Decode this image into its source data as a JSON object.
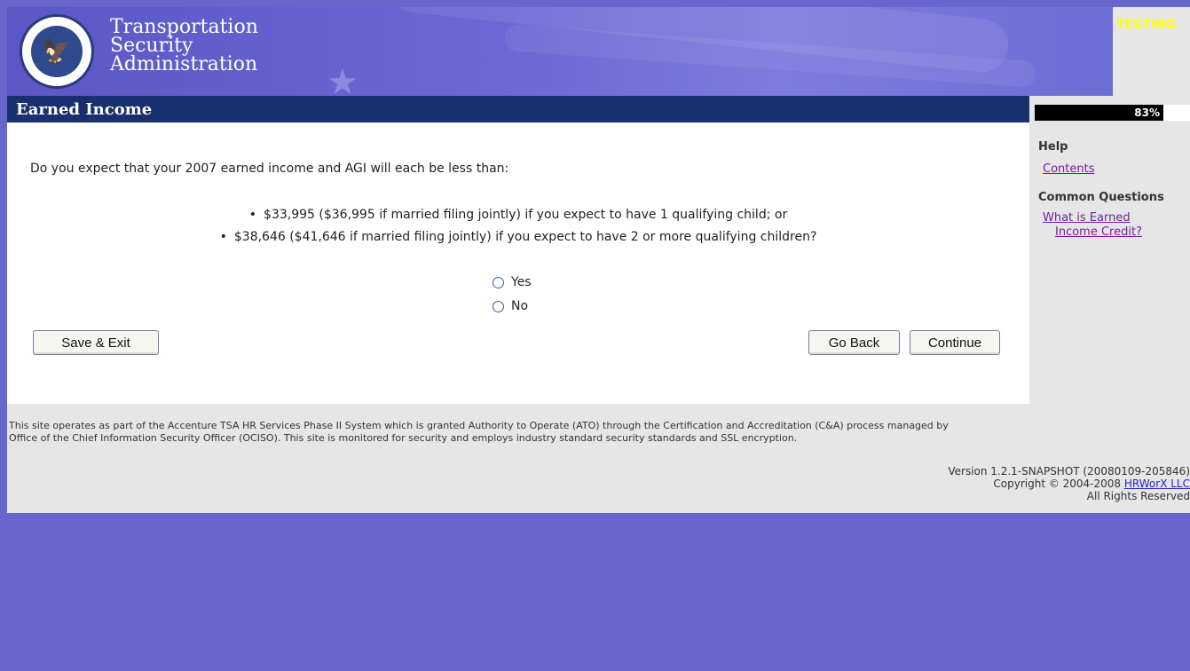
{
  "header": {
    "org_line1": "Transportation",
    "org_line2": "Security",
    "org_line3": "Administration",
    "env_badge": "TESTING"
  },
  "page": {
    "title": "Earned Income",
    "progress_label": "83%",
    "progress": 0.83
  },
  "question": {
    "text": "Do you expect that your 2007 earned income and AGI will each be less than:",
    "conditions": [
      "$33,995 ($36,995 if married filing jointly) if you expect to have 1 qualifying child; or",
      "$38,646 ($41,646 if married filing jointly) if you expect to have 2 or more qualifying children?"
    ],
    "options": [
      "Yes",
      "No"
    ]
  },
  "buttons": {
    "save_exit": "Save & Exit",
    "go_back": "Go Back",
    "continue": "Continue"
  },
  "sidebar": {
    "help_heading": "Help",
    "contents_link": "Contents",
    "common_heading": "Common Questions",
    "faq_link_line1": "What is Earned",
    "faq_link_line2": "Income Credit?"
  },
  "footer": {
    "notice_line1": "This site operates as part of the Accenture TSA HR Services Phase II System which is granted Authority to Operate (ATO) through the Certification and Accreditation (C&A) process managed by",
    "notice_line2": "Office of the Chief Information Security Officer (OCISO). This site is monitored for security and employs industry standard security standards and SSL encryption.",
    "version": "Version 1.2.1-SNAPSHOT (20080109-205846)",
    "copyright_prefix": "Copyright © 2004-2008",
    "copyright_link": "HRWorX LLC",
    "rights": "All Rights Reserved"
  },
  "colors": {
    "background": "#6666cc",
    "title_bar": "#1a2f6e",
    "sidebar": "#e6e6e6",
    "link": "#7a1aa0"
  }
}
